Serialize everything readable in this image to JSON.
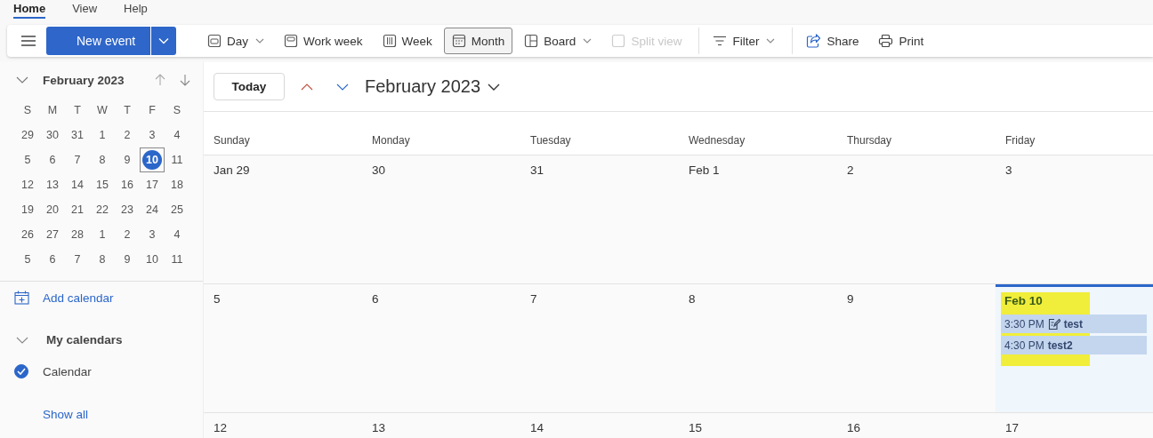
{
  "tabs": [
    {
      "label": "Home",
      "selected": true
    },
    {
      "label": "View",
      "selected": false
    },
    {
      "label": "Help",
      "selected": false
    }
  ],
  "toolbar": {
    "new_event": "New event",
    "views": [
      {
        "label": "Day",
        "dropdown": true,
        "selected": false,
        "disabled": false
      },
      {
        "label": "Work week",
        "dropdown": false,
        "selected": false,
        "disabled": false
      },
      {
        "label": "Week",
        "dropdown": false,
        "selected": false,
        "disabled": false
      },
      {
        "label": "Month",
        "dropdown": false,
        "selected": true,
        "disabled": false
      },
      {
        "label": "Board",
        "dropdown": true,
        "selected": false,
        "disabled": false
      },
      {
        "label": "Split view",
        "dropdown": false,
        "selected": false,
        "disabled": true
      }
    ],
    "filter": "Filter",
    "share": "Share",
    "print": "Print"
  },
  "mini_calendar": {
    "title": "February 2023",
    "weekdays": [
      "S",
      "M",
      "T",
      "W",
      "T",
      "F",
      "S"
    ],
    "weeks": [
      [
        {
          "label": "29",
          "selected": false
        },
        {
          "label": "30",
          "selected": false
        },
        {
          "label": "31",
          "selected": false
        },
        {
          "label": "1",
          "selected": false
        },
        {
          "label": "2",
          "selected": false
        },
        {
          "label": "3",
          "selected": false
        },
        {
          "label": "4",
          "selected": false
        }
      ],
      [
        {
          "label": "5",
          "selected": false
        },
        {
          "label": "6",
          "selected": false
        },
        {
          "label": "7",
          "selected": false
        },
        {
          "label": "8",
          "selected": false
        },
        {
          "label": "9",
          "selected": false
        },
        {
          "label": "10",
          "selected": true
        },
        {
          "label": "11",
          "selected": false
        }
      ],
      [
        {
          "label": "12",
          "selected": false
        },
        {
          "label": "13",
          "selected": false
        },
        {
          "label": "14",
          "selected": false
        },
        {
          "label": "15",
          "selected": false
        },
        {
          "label": "16",
          "selected": false
        },
        {
          "label": "17",
          "selected": false
        },
        {
          "label": "18",
          "selected": false
        }
      ],
      [
        {
          "label": "19",
          "selected": false
        },
        {
          "label": "20",
          "selected": false
        },
        {
          "label": "21",
          "selected": false
        },
        {
          "label": "22",
          "selected": false
        },
        {
          "label": "23",
          "selected": false
        },
        {
          "label": "24",
          "selected": false
        },
        {
          "label": "25",
          "selected": false
        }
      ],
      [
        {
          "label": "26",
          "selected": false
        },
        {
          "label": "27",
          "selected": false
        },
        {
          "label": "28",
          "selected": false
        },
        {
          "label": "1",
          "selected": false
        },
        {
          "label": "2",
          "selected": false
        },
        {
          "label": "3",
          "selected": false
        },
        {
          "label": "4",
          "selected": false
        }
      ],
      [
        {
          "label": "5",
          "selected": false
        },
        {
          "label": "6",
          "selected": false
        },
        {
          "label": "7",
          "selected": false
        },
        {
          "label": "8",
          "selected": false
        },
        {
          "label": "9",
          "selected": false
        },
        {
          "label": "10",
          "selected": false
        },
        {
          "label": "11",
          "selected": false
        }
      ]
    ]
  },
  "sidebar": {
    "add_calendar": "Add calendar",
    "section": {
      "title": "My calendars",
      "expanded": true
    },
    "calendars": [
      {
        "name": "Calendar",
        "checked": true,
        "color": "#2b66c9"
      }
    ],
    "show_all": "Show all"
  },
  "main": {
    "today_button": "Today",
    "title": "February 2023",
    "day_headers": [
      "Sunday",
      "Monday",
      "Tuesday",
      "Wednesday",
      "Thursday",
      "Friday"
    ],
    "weeks": [
      [
        {
          "label": "Jan 29",
          "today": false
        },
        {
          "label": "30",
          "today": false
        },
        {
          "label": "31",
          "today": false
        },
        {
          "label": "Feb 1",
          "today": false
        },
        {
          "label": "2",
          "today": false
        },
        {
          "label": "3",
          "today": false
        }
      ],
      [
        {
          "label": "5",
          "today": false
        },
        {
          "label": "6",
          "today": false
        },
        {
          "label": "7",
          "today": false
        },
        {
          "label": "8",
          "today": false
        },
        {
          "label": "9",
          "today": false
        },
        {
          "label": "Feb 10",
          "today": true,
          "highlighted": true,
          "events": [
            {
              "time": "3:30 PM",
              "title": "test",
              "note": true
            },
            {
              "time": "4:30 PM",
              "title": "test2",
              "note": false
            }
          ]
        }
      ],
      [
        {
          "label": "12",
          "today": false
        },
        {
          "label": "13",
          "today": false
        },
        {
          "label": "14",
          "today": false
        },
        {
          "label": "15",
          "today": false
        },
        {
          "label": "16",
          "today": false
        },
        {
          "label": "17",
          "today": false
        }
      ]
    ]
  }
}
